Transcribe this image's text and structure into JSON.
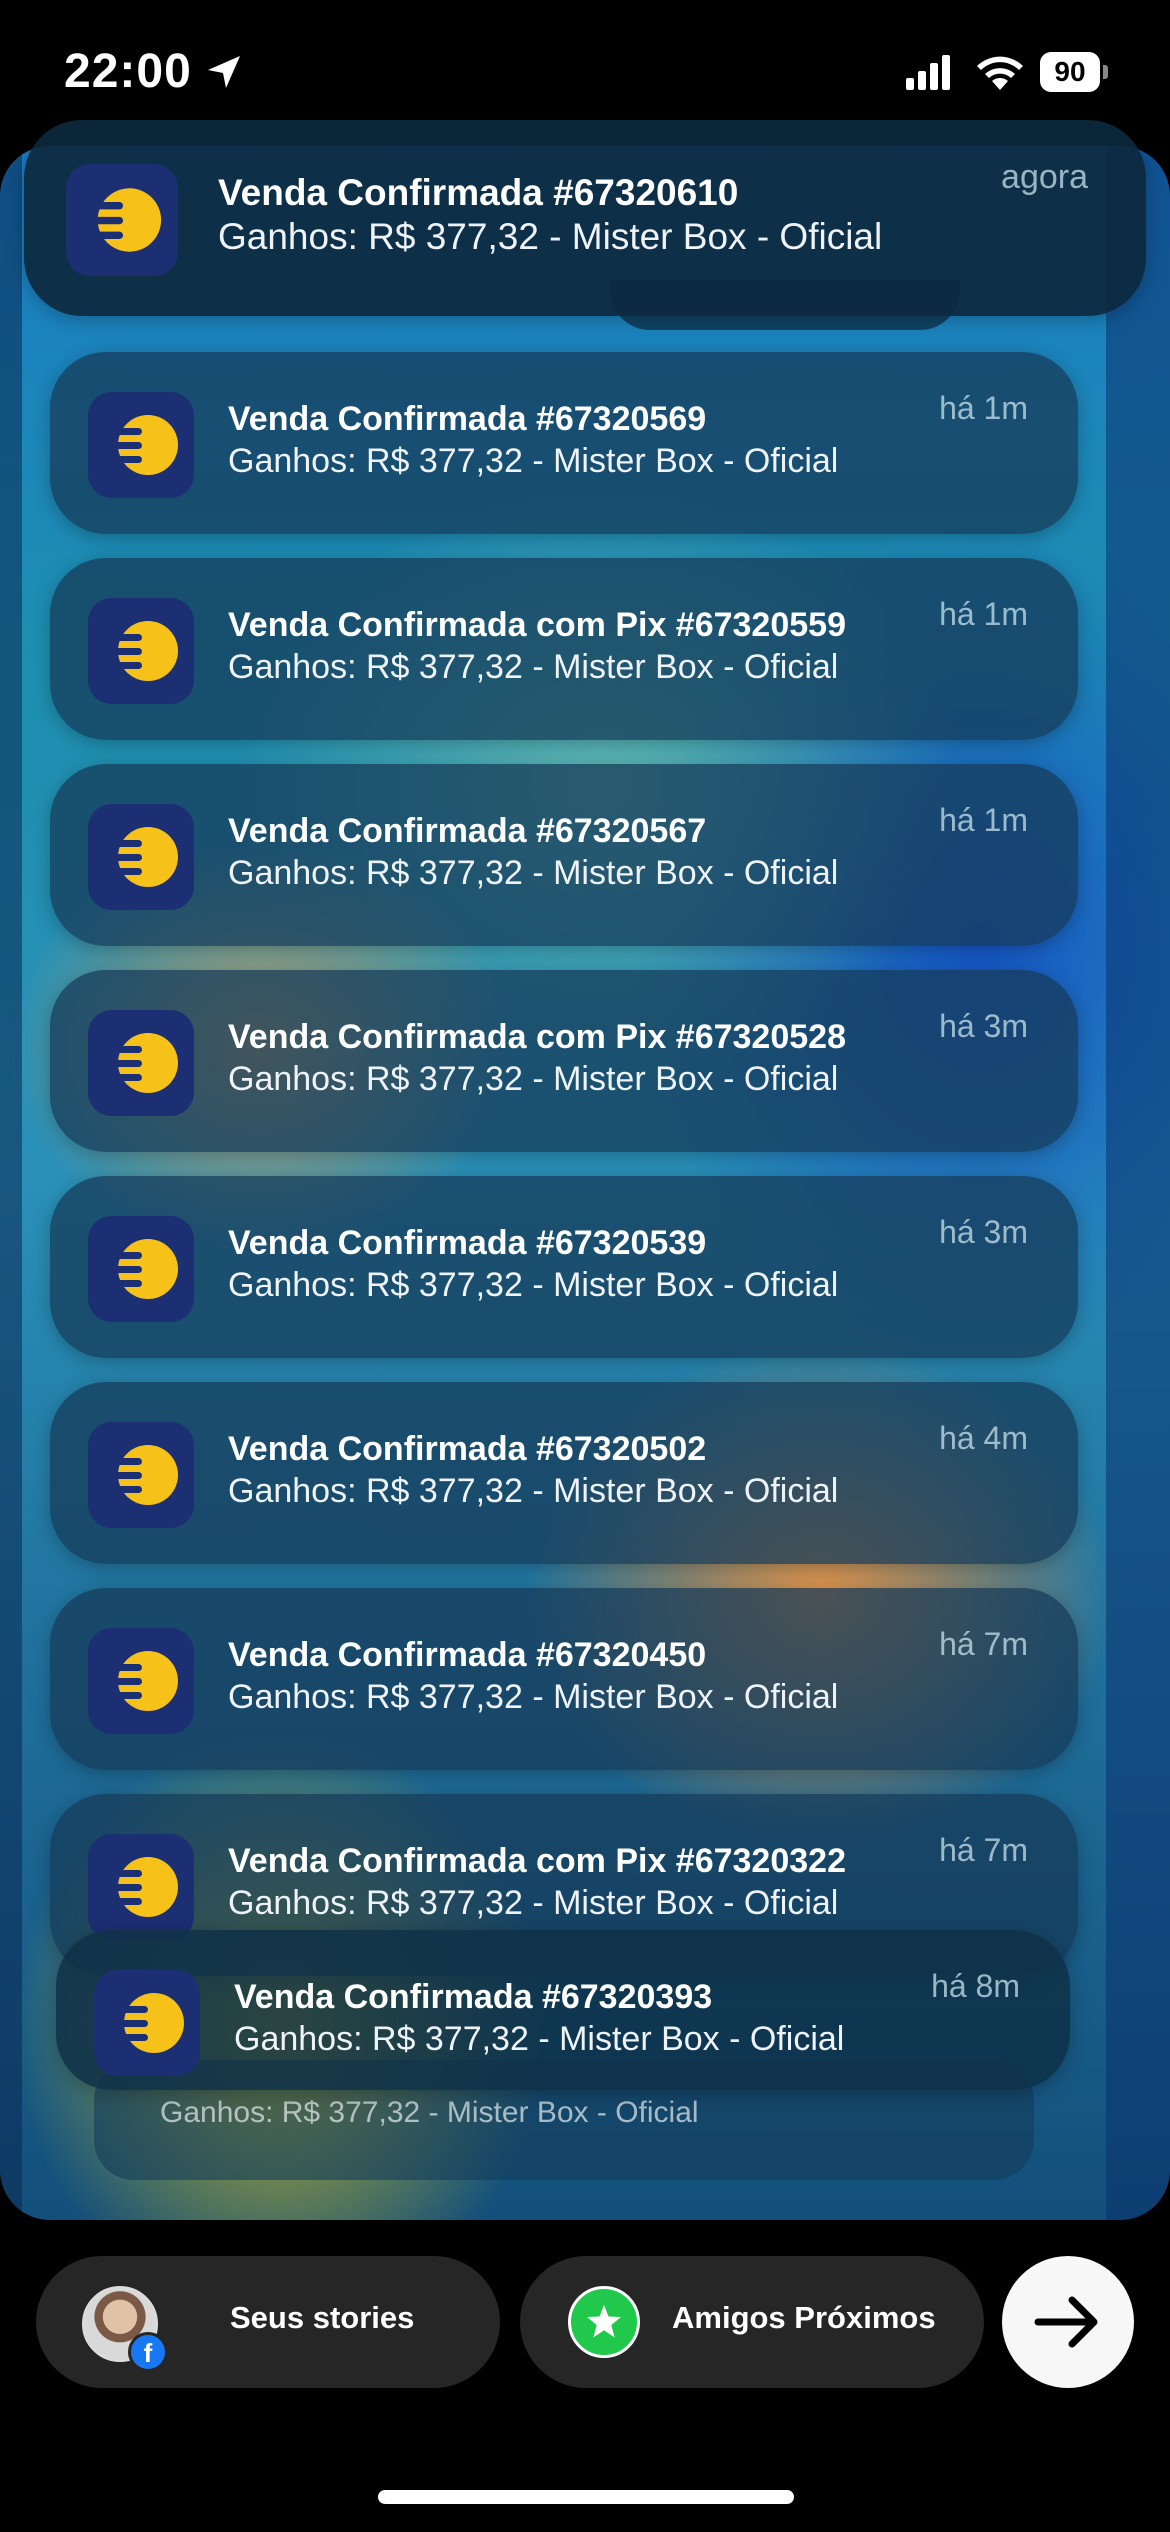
{
  "status_bar": {
    "time": "22:00",
    "battery": "90",
    "icons": [
      "location-arrow-icon",
      "cellular-signal-icon",
      "wifi-icon",
      "battery-icon"
    ]
  },
  "notifications": [
    {
      "title": "Venda Confirmada #67320610",
      "body": "Ganhos: R$ 377,32 - Mister Box - Oficial",
      "time": "agora"
    },
    {
      "title": "Venda Confirmada #67320569",
      "body": "Ganhos: R$ 377,32 - Mister Box - Oficial",
      "time": "há 1m"
    },
    {
      "title": "Venda Confirmada com Pix #67320559",
      "body": "Ganhos: R$ 377,32 - Mister Box - Oficial",
      "time": "há 1m"
    },
    {
      "title": "Venda Confirmada #67320567",
      "body": "Ganhos: R$ 377,32 - Mister Box - Oficial",
      "time": "há 1m"
    },
    {
      "title": "Venda Confirmada com Pix #67320528",
      "body": "Ganhos: R$ 377,32 - Mister Box - Oficial",
      "time": "há 3m"
    },
    {
      "title": "Venda Confirmada #67320539",
      "body": "Ganhos: R$ 377,32 - Mister Box - Oficial",
      "time": "há 3m"
    },
    {
      "title": "Venda Confirmada #67320502",
      "body": "Ganhos: R$ 377,32 - Mister Box - Oficial",
      "time": "há 4m"
    },
    {
      "title": "Venda Confirmada #67320450",
      "body": "Ganhos: R$ 377,32 - Mister Box - Oficial",
      "time": "há 7m"
    },
    {
      "title": "Venda Confirmada com Pix #67320322",
      "body": "Ganhos: R$ 377,32 - Mister Box - Oficial",
      "time": "há 7m"
    },
    {
      "title": "Venda Confirmada #67320393",
      "body": "Ganhos: R$ 377,32 - Mister Box - Oficial",
      "time": "há 8m"
    }
  ],
  "ghost_notification": {
    "body": "Ganhos: R$ 377,32 - Mister Box - Oficial"
  },
  "bottom_bar": {
    "stories_label": "Seus stories",
    "close_friends_label": "Amigos Próximos",
    "facebook_badge": "f"
  },
  "colors": {
    "app_icon_bg": "#1d2f73",
    "app_icon_fg": "#f6c21a",
    "close_friends_green": "#20c94b",
    "facebook_blue": "#1877f2"
  }
}
